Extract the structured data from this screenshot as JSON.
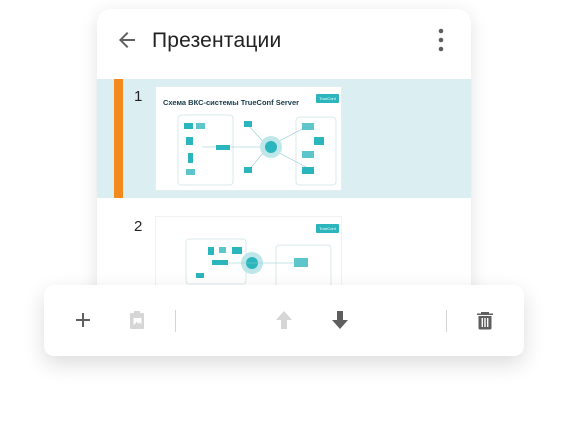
{
  "header": {
    "title": "Презентации"
  },
  "slides": [
    {
      "number": "1",
      "title": "Схема ВКС-системы TrueConf Server",
      "logo": "TrueConf",
      "selected": true
    },
    {
      "number": "2",
      "title": "",
      "logo": "TrueConf",
      "selected": false
    }
  ],
  "toolbar": {
    "items": [
      {
        "name": "add-slide-button",
        "icon": "plus-icon",
        "enabled": true
      },
      {
        "name": "paste-slide-button",
        "icon": "clipboard-image-icon",
        "enabled": false
      },
      {
        "name": "move-up-button",
        "icon": "arrow-up-icon",
        "enabled": false
      },
      {
        "name": "move-down-button",
        "icon": "arrow-down-icon",
        "enabled": true
      },
      {
        "name": "delete-slide-button",
        "icon": "trash-icon",
        "enabled": true
      }
    ]
  },
  "colors": {
    "accent": "#f28a1e",
    "selected_row": "#dbeff3",
    "icon": "#5f5f5f",
    "icon_disabled": "#cfcfcf",
    "diagram": "#2bb5bd"
  }
}
